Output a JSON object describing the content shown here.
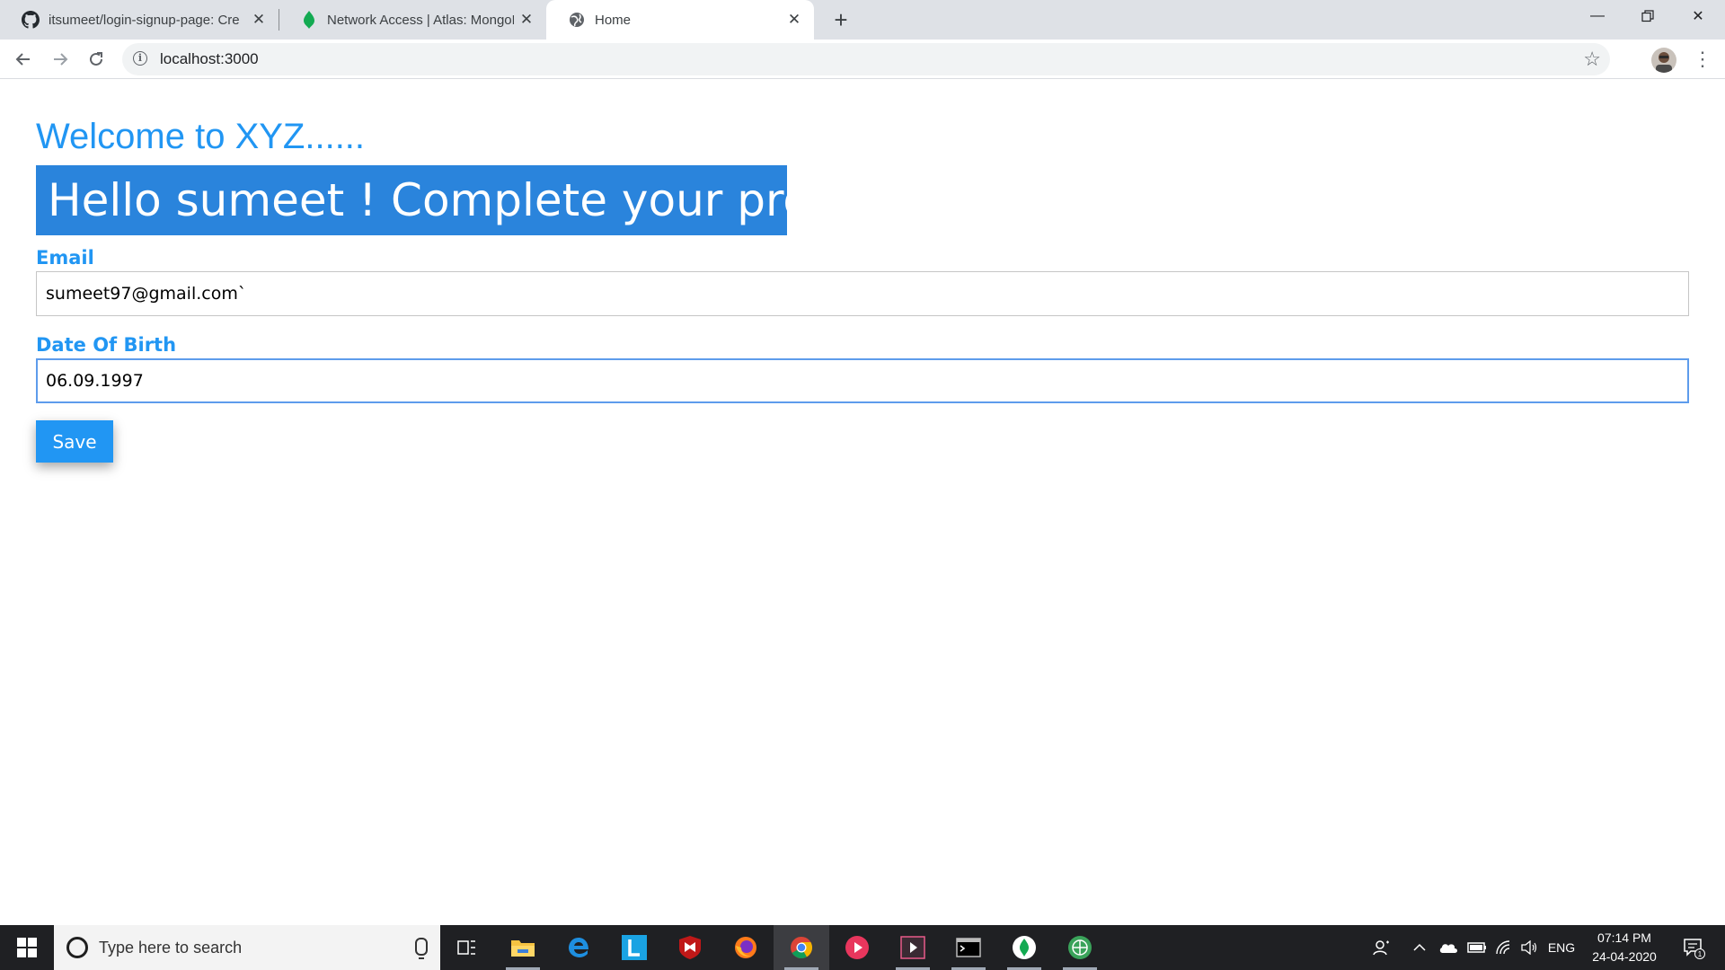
{
  "browser": {
    "tabs": [
      {
        "title": "itsumeet/login-signup-page: Cre",
        "favicon": "github-icon",
        "active": false
      },
      {
        "title": "Network Access | Atlas: MongoDB",
        "favicon": "mongodb-leaf-icon",
        "active": false
      },
      {
        "title": "Home",
        "favicon": "globe-icon",
        "active": true
      }
    ],
    "new_tab_icon": "plus-icon",
    "address": "localhost:3000"
  },
  "page": {
    "welcome": "Welcome to XYZ......",
    "greeting": "Hello sumeet ! Complete your profile",
    "email_label": "Email",
    "email_value": "sumeet97@gmail.com`",
    "dob_label": "Date Of Birth",
    "dob_value": "06.09.1997",
    "save_label": "Save"
  },
  "colors": {
    "accent": "#2196f3",
    "greeting_bg": "#2a84dc",
    "taskbar_bg": "#1f2023"
  },
  "taskbar": {
    "search_placeholder": "Type here to search",
    "apps": [
      "task-view-icon",
      "file-explorer-icon",
      "edge-icon",
      "l-app-icon",
      "mcafee-icon",
      "firefox-icon",
      "chrome-icon",
      "media-player-icon",
      "video-editor-icon",
      "terminal-icon",
      "mongodb-compass-icon",
      "network-app-icon"
    ],
    "language": "ENG",
    "time": "07:14 PM",
    "date": "24-04-2020",
    "notification_count": "1"
  }
}
